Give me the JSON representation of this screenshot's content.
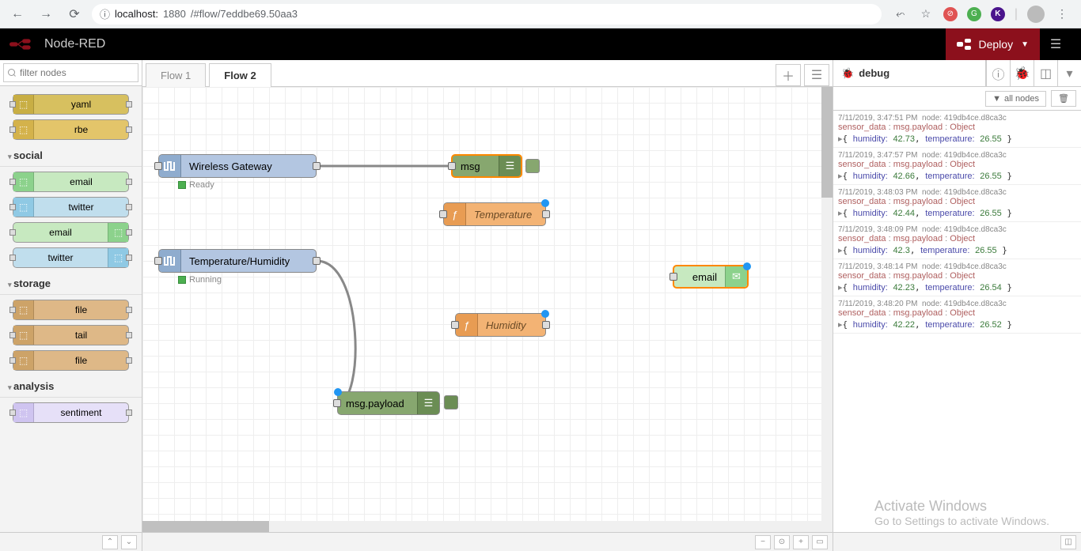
{
  "browser": {
    "url_host": "localhost:",
    "url_port": "1880",
    "url_path": "/#flow/7eddbe69.50aa3"
  },
  "header": {
    "title": "Node-RED",
    "deploy": "Deploy"
  },
  "palette": {
    "filter_placeholder": "filter nodes",
    "nodes_top": [
      {
        "label": "yaml",
        "cls": "c-yaml"
      },
      {
        "label": "rbe",
        "cls": "c-rbe"
      }
    ],
    "cat_social": "social",
    "nodes_social": [
      {
        "label": "email",
        "cls": "c-email-in",
        "icon_pos": "l"
      },
      {
        "label": "twitter",
        "cls": "c-twitter-in",
        "icon_pos": "l"
      },
      {
        "label": "email",
        "cls": "c-email-out",
        "icon_pos": "r"
      },
      {
        "label": "twitter",
        "cls": "c-twitter-out",
        "icon_pos": "r"
      }
    ],
    "cat_storage": "storage",
    "nodes_storage": [
      {
        "label": "file",
        "cls": "c-file"
      },
      {
        "label": "tail",
        "cls": "c-file"
      },
      {
        "label": "file",
        "cls": "c-file"
      }
    ],
    "cat_analysis": "analysis",
    "nodes_analysis": [
      {
        "label": "sentiment",
        "cls": "c-sentiment"
      }
    ]
  },
  "tabs": {
    "t1": "Flow 1",
    "t2": "Flow 2"
  },
  "flow": {
    "n_gateway": "Wireless Gateway",
    "n_gateway_status": "Ready",
    "n_msg": "msg",
    "n_temp": "Temperature",
    "n_th": "Temperature/Humidity",
    "n_th_status": "Running",
    "n_hum": "Humidity",
    "n_email": "email",
    "n_payload": "msg.payload"
  },
  "sidebar": {
    "tab": "debug",
    "filter": "all nodes"
  },
  "debug": [
    {
      "ts": "7/11/2019, 3:47:51 PM",
      "node": "419db4ce.d8ca3c",
      "topic": "sensor_data",
      "prop": "msg.payload",
      "type": "Object",
      "h": "42.73",
      "t": "26.55"
    },
    {
      "ts": "7/11/2019, 3:47:57 PM",
      "node": "419db4ce.d8ca3c",
      "topic": "sensor_data",
      "prop": "msg.payload",
      "type": "Object",
      "h": "42.66",
      "t": "26.55"
    },
    {
      "ts": "7/11/2019, 3:48:03 PM",
      "node": "419db4ce.d8ca3c",
      "topic": "sensor_data",
      "prop": "msg.payload",
      "type": "Object",
      "h": "42.44",
      "t": "26.55"
    },
    {
      "ts": "7/11/2019, 3:48:09 PM",
      "node": "419db4ce.d8ca3c",
      "topic": "sensor_data",
      "prop": "msg.payload",
      "type": "Object",
      "h": "42.3",
      "t": "26.55"
    },
    {
      "ts": "7/11/2019, 3:48:14 PM",
      "node": "419db4ce.d8ca3c",
      "topic": "sensor_data",
      "prop": "msg.payload",
      "type": "Object",
      "h": "42.23",
      "t": "26.54"
    },
    {
      "ts": "7/11/2019, 3:48:20 PM",
      "node": "419db4ce.d8ca3c",
      "topic": "sensor_data",
      "prop": "msg.payload",
      "type": "Object",
      "h": "42.22",
      "t": "26.52"
    }
  ],
  "watermark": {
    "t1": "Activate Windows",
    "t2": "Go to Settings to activate Windows."
  }
}
